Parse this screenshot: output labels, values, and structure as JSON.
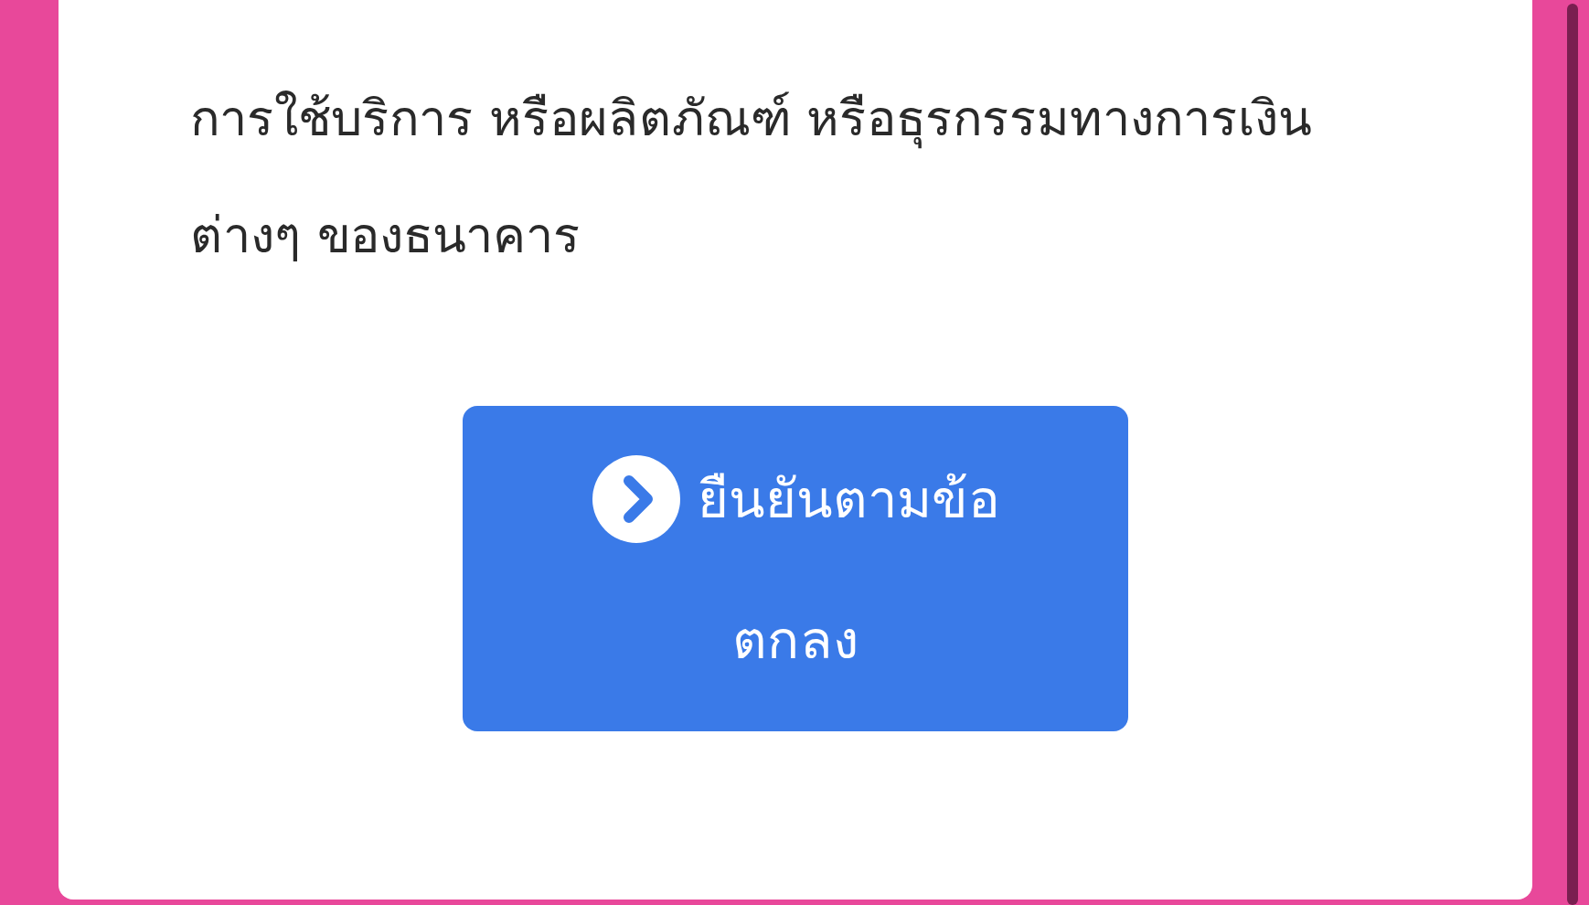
{
  "consent_text": {
    "lines": [
      "การใช้บริการ หรือผลิตภัณฑ์ หรือธุรกรรมทางการเงิน",
      "ต่างๆ ของธนาคาร"
    ]
  },
  "confirm_button": {
    "lines": [
      "ยืนยันตามข้อ",
      "ตกลง"
    ]
  }
}
